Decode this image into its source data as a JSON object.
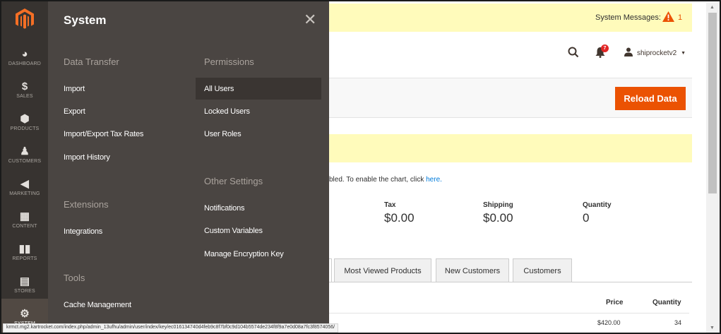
{
  "nav": {
    "items": [
      {
        "label": "DASHBOARD",
        "icon": "dashboard-icon"
      },
      {
        "label": "SALES",
        "icon": "dollar-icon"
      },
      {
        "label": "PRODUCTS",
        "icon": "cube-icon"
      },
      {
        "label": "CUSTOMERS",
        "icon": "person-icon"
      },
      {
        "label": "MARKETING",
        "icon": "megaphone-icon"
      },
      {
        "label": "CONTENT",
        "icon": "layout-icon"
      },
      {
        "label": "REPORTS",
        "icon": "bar-chart-icon"
      },
      {
        "label": "STORES",
        "icon": "store-icon"
      },
      {
        "label": "SYSTEM",
        "icon": "gear-icon"
      }
    ]
  },
  "flyout": {
    "title": "System",
    "sections": {
      "data_transfer": {
        "title": "Data Transfer",
        "links": [
          "Import",
          "Export",
          "Import/Export Tax Rates",
          "Import History"
        ]
      },
      "permissions": {
        "title": "Permissions",
        "links": [
          "All Users",
          "Locked Users",
          "User Roles"
        ]
      },
      "other_settings": {
        "title": "Other Settings",
        "links": [
          "Notifications",
          "Custom Variables",
          "Manage Encryption Key"
        ]
      },
      "extensions": {
        "title": "Extensions",
        "links": [
          "Integrations"
        ]
      },
      "tools": {
        "title": "Tools",
        "links": [
          "Cache Management"
        ]
      }
    }
  },
  "header": {
    "system_messages_label": "System Messages:",
    "system_messages_count": "1",
    "notification_count": "7",
    "username": "shiprocketv2"
  },
  "reload_button": "Reload Data",
  "chart_notice": {
    "text": "bled. To enable the chart, click ",
    "link": "here."
  },
  "totals": [
    {
      "label": "Tax",
      "value": "$0.00"
    },
    {
      "label": "Shipping",
      "value": "$0.00"
    },
    {
      "label": "Quantity",
      "value": "0"
    }
  ],
  "tabs": [
    "Most Viewed Products",
    "New Customers",
    "Customers"
  ],
  "table": {
    "headers": [
      "Price",
      "Quantity"
    ],
    "row": [
      "$420.00",
      "34"
    ]
  },
  "status_url": "krmct.mg2.kartrocket.com/index.php/admin_13ufhu/admin/user/index/key/ec016134740d4feb9c8f7bf0c9d104b5574de234f8f9a7e0d08a7fc3f8574056/",
  "colors": {
    "nav_bg": "#373330",
    "flyout_bg": "#4a4542",
    "accent": "#eb5202",
    "notice_bg": "#fffbbb"
  }
}
